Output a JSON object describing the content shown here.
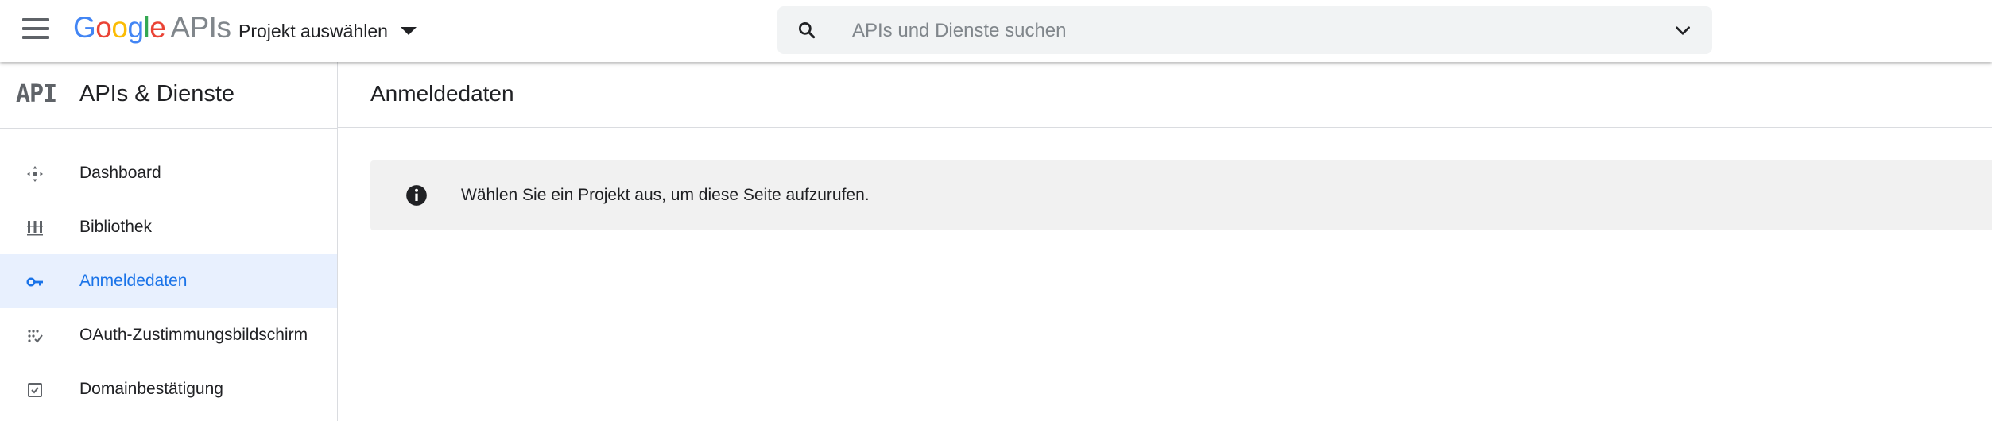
{
  "header": {
    "logo": {
      "brand_letters": [
        "G",
        "o",
        "o",
        "g",
        "l",
        "e"
      ],
      "product": "APIs"
    },
    "project_select_label": "Projekt auswählen",
    "search": {
      "placeholder": "APIs und Dienste suchen",
      "value": ""
    },
    "icons": {
      "menu": "hamburger-menu-icon",
      "search": "search-icon",
      "expand": "chevron-down-icon",
      "dropdown": "caret-down-icon"
    }
  },
  "sidebar": {
    "logo_text": "API",
    "title": "APIs & Dienste",
    "items": [
      {
        "label": "Dashboard",
        "icon": "dashboard-icon",
        "active": false
      },
      {
        "label": "Bibliothek",
        "icon": "library-icon",
        "active": false
      },
      {
        "label": "Anmeldedaten",
        "icon": "key-icon",
        "active": true
      },
      {
        "label": "OAuth-Zustimmungsbildschirm",
        "icon": "consent-screen-icon",
        "active": false
      },
      {
        "label": "Domainbestätigung",
        "icon": "checkbox-icon",
        "active": false
      }
    ]
  },
  "main": {
    "title": "Anmeldedaten",
    "info_message": "Wählen Sie ein Projekt aus, um diese Seite aufzurufen.",
    "info_icon": "info-icon"
  },
  "colors": {
    "accent": "#1a73e8",
    "active_bg": "#e8f0fe",
    "info_bg": "#f1f1f1",
    "search_bg": "#f1f3f4",
    "google_blue": "#4285F4",
    "google_red": "#EA4335",
    "google_yellow": "#FBBC05",
    "google_green": "#34A853"
  }
}
